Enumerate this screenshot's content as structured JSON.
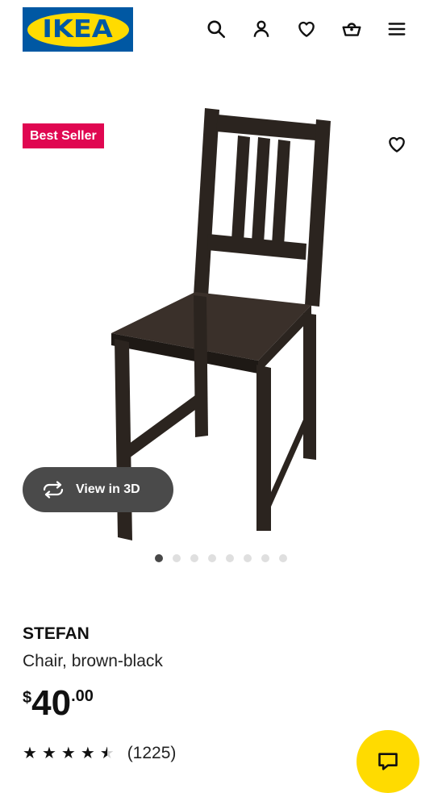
{
  "header": {
    "logo_text": "IKEA",
    "icons": [
      "search-icon",
      "user-icon",
      "heart-icon",
      "basket-icon",
      "menu-icon"
    ]
  },
  "gallery": {
    "badge": "Best Seller",
    "view3d_label": "View in 3D",
    "dots_count": 8,
    "active_dot": 1
  },
  "product": {
    "name": "STEFAN",
    "description": "Chair, brown-black",
    "price": {
      "currency": "$",
      "integer": "40",
      "decimal": ".00"
    },
    "rating": {
      "stars": 4.5,
      "max": 5,
      "count_text": "(1225)"
    }
  },
  "colors": {
    "ikea_blue": "#0058a3",
    "ikea_yellow": "#ffdb00",
    "badge_red": "#e00751",
    "chair": "#2b241f"
  }
}
